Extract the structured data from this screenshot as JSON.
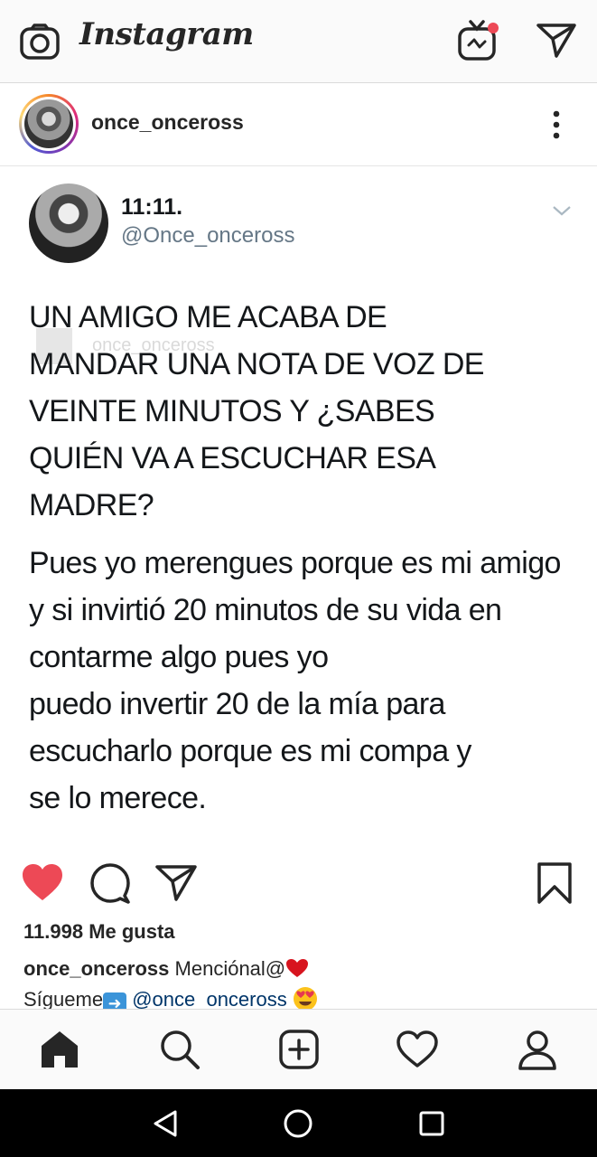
{
  "app": {
    "logo_text": "Instagram",
    "accent": "#ed4956"
  },
  "topbar": {
    "icons": [
      "camera-icon",
      "igtv-icon",
      "direct-message-icon"
    ]
  },
  "post": {
    "username": "once_onceross",
    "more_icon": "more-vertical-icon"
  },
  "tweet": {
    "display_name": "11:11.",
    "handle": "@Once_onceross",
    "watermark": "once_onceross",
    "paragraph_1": "UN AMIGO ME ACABA DE\nMANDAR UNA NOTA DE VOZ DE\nVEINTE MINUTOS Y ¿SABES\nQUIÉN VA A ESCUCHAR ESA\nMADRE?",
    "paragraph_2": "Pues yo merengues porque es mi amigo\ny si invirtió 20 minutos de su vida en\ncontarme algo pues yo\npuedo invertir 20 de la mía para\nescucharlo porque es mi compa y\nse lo merece."
  },
  "actions": {
    "liked": true,
    "icons": [
      "heart-icon",
      "comment-icon",
      "share-icon",
      "bookmark-icon"
    ]
  },
  "likes_text": "11.998 Me gusta",
  "caption": {
    "username": "once_onceross",
    "text_1": "Menciónal@",
    "text_2": "Sígueme",
    "mention": "@once_onceross"
  },
  "bottom_nav": [
    "home-icon",
    "search-icon",
    "add-post-icon",
    "activity-heart-icon",
    "profile-icon"
  ],
  "system_nav": [
    "back-icon",
    "home-circle-icon",
    "recents-icon"
  ]
}
